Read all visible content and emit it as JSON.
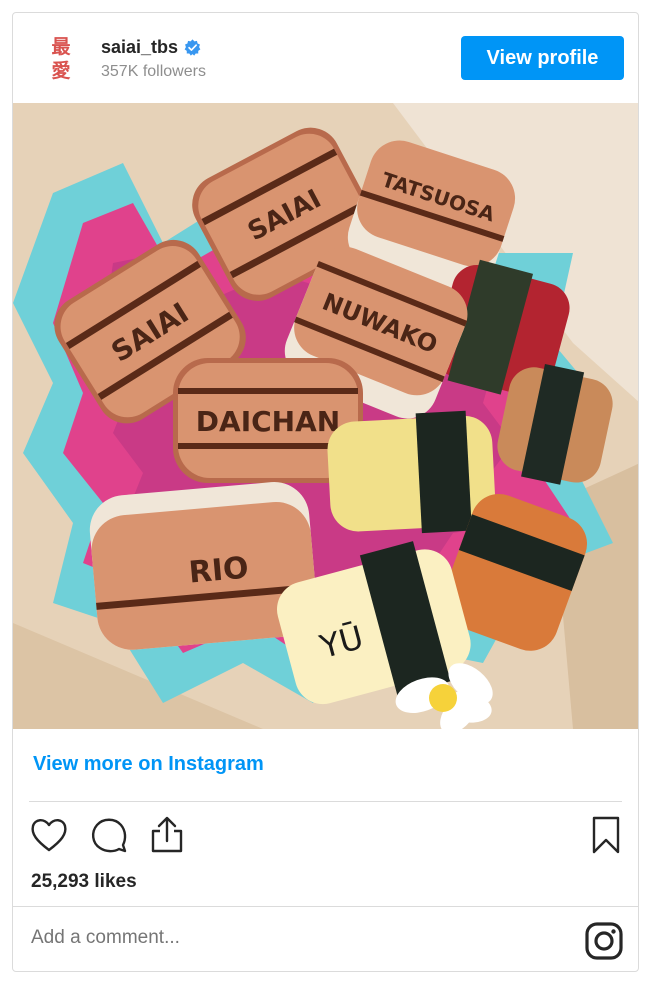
{
  "profile": {
    "avatar_text": [
      "最",
      "愛"
    ],
    "username": "saiai_tbs",
    "followers": "357K followers",
    "view_profile_label": "View profile"
  },
  "post": {
    "image_description_labels": [
      "SAIAI",
      "SAIAI",
      "TATSUOSA",
      "SAIAI",
      "NUWAKO",
      "DAICHAN",
      "RIO",
      "YŪ"
    ],
    "view_more_label": "View more on Instagram",
    "likes": "25,293 likes",
    "comment_placeholder": "Add a comment..."
  },
  "icons": [
    "verified-badge-icon",
    "heart-icon",
    "comment-icon",
    "share-icon",
    "bookmark-icon",
    "instagram-icon"
  ],
  "colors": {
    "accent": "#0095f6",
    "text": "#262626",
    "muted": "#8e8e8e",
    "border": "#dbdbdb"
  }
}
